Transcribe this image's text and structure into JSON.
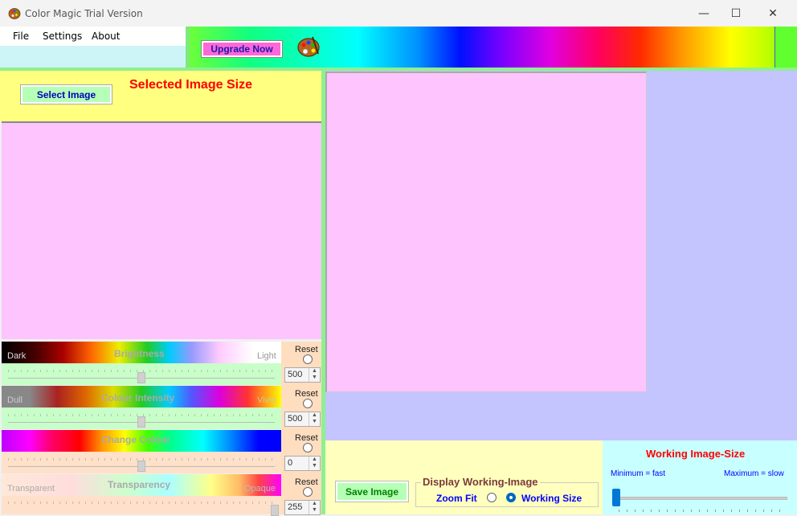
{
  "window": {
    "title": "Color Magic Trial Version",
    "minimize_glyph": "—",
    "maximize_glyph": "☐",
    "close_glyph": "✕"
  },
  "menu": {
    "file": "File",
    "settings": "Settings",
    "about": "About"
  },
  "toolbar": {
    "upgrade_label": "Upgrade Now"
  },
  "left_panel": {
    "select_image_label": "Select Image",
    "selected_image_size_label": "Selected Image Size"
  },
  "adjustments": {
    "brightness": {
      "title": "Brightness",
      "left": "Dark",
      "right": "Light",
      "reset": "Reset",
      "value": "500",
      "level": 0.5
    },
    "colour_intensity": {
      "title": "Colour Intensity",
      "left": "Dull",
      "right": "Vivid",
      "reset": "Reset",
      "value": "500",
      "level": 0.5
    },
    "change_colour": {
      "title": "Change Colour",
      "reset": "Reset",
      "value": "0",
      "level": 0.5
    },
    "transparency": {
      "title": "Transparency",
      "left": "Transparent",
      "right": "Opaque",
      "reset": "Reset",
      "value": "255",
      "level": 1.0
    }
  },
  "bottom": {
    "save_label": "Save Image",
    "display_group_title": "Display Working-Image",
    "zoom_fit_label": "Zoom Fit",
    "working_size_label": "Working Size",
    "selected_option": "Working Size"
  },
  "working_image_size": {
    "title": "Working Image-Size",
    "min_label": "Minimum = fast",
    "max_label": "Maximum = slow",
    "level": 0.0
  },
  "colors": {
    "panel_yellow": "#ffff80",
    "image_pink": "#fdc4fd",
    "right_lavender": "#c4c4ff",
    "accent_green": "#8ef08e"
  },
  "icons": {
    "app": "palette-icon",
    "upgrade_art": "palette-icon"
  }
}
